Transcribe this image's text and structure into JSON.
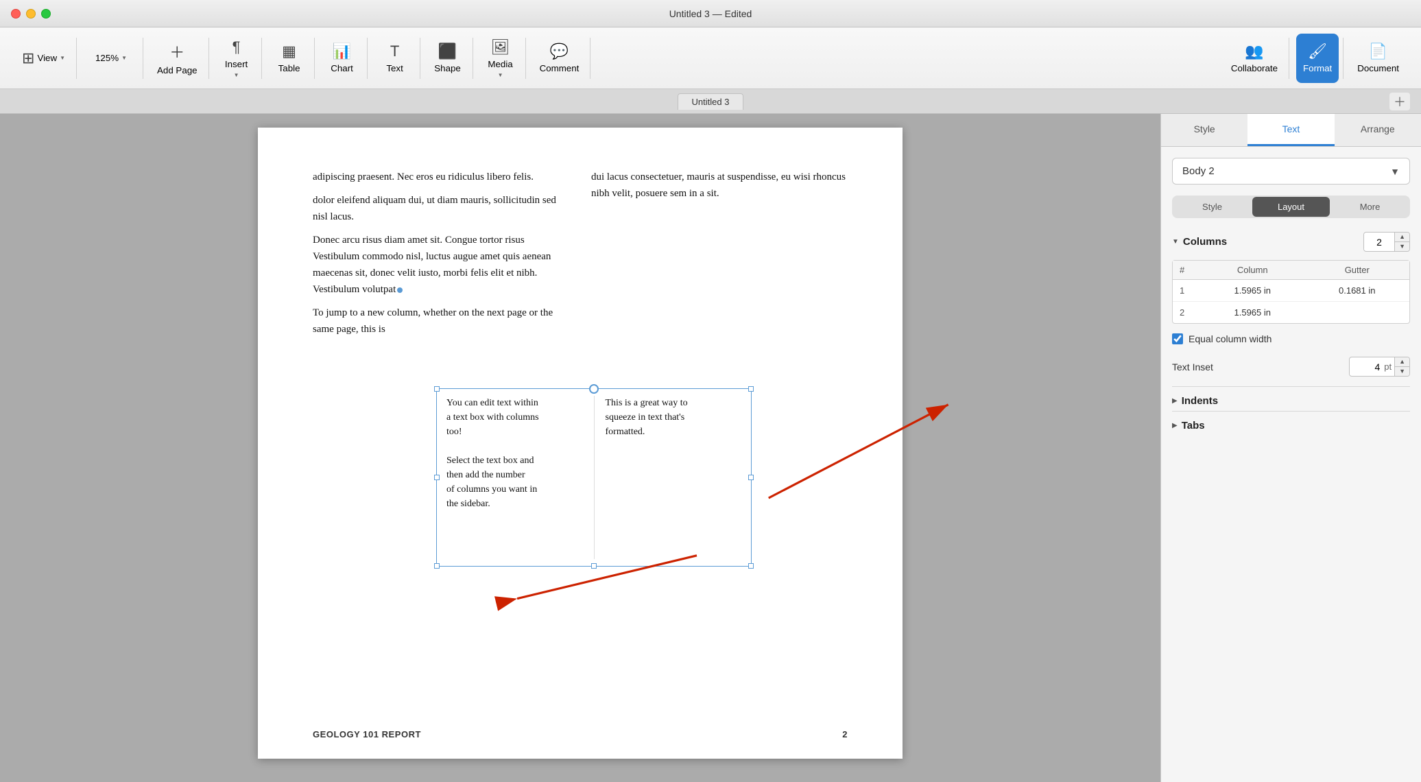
{
  "window": {
    "title": "Untitled 3 — Edited",
    "lock_icon": "🔒"
  },
  "titlebar_dots": {
    "red": "red",
    "yellow": "yellow",
    "green": "green"
  },
  "toolbar": {
    "view_label": "View",
    "zoom_label": "125%",
    "add_page_label": "Add Page",
    "insert_label": "Insert",
    "table_label": "Table",
    "chart_label": "Chart",
    "text_label": "Text",
    "shape_label": "Shape",
    "media_label": "Media",
    "comment_label": "Comment",
    "collaborate_label": "Collaborate",
    "format_label": "Format",
    "document_label": "Document"
  },
  "tab_bar": {
    "doc_name": "Untitled 3"
  },
  "page": {
    "body_text_col1_p1": "adipiscing praesent. Nec eros eu ridiculus libero felis.",
    "body_text_col1_p2": "Donec arcu risus diam amet sit. Congue tortor risus Vestibulum commodo nisl, luctus augue amet quis aenean maecenas sit, donec velit iusto, morbi felis elit et nibh. Vestibulum volutpat",
    "body_text_col1_p3": "dui lacus consectetuer, mauris at suspendisse, eu wisi rhoncus nibh velit, posuere sem in a sit.",
    "body_text_col2_p1": "dolor eleifend aliquam dui, ut diam mauris, sollicitudin sed nisl lacus.",
    "body_text_col2_p2": "To jump to a new column, whether on the next page or the same page, this is",
    "footer_left": "GEOLOGY 101 REPORT",
    "footer_right": "2"
  },
  "text_box": {
    "col1_line1": "You can edit text within",
    "col1_line2": "a text box with columns",
    "col1_line3": "too!",
    "col1_line4": "Select the text box and",
    "col1_line5": "then add the number",
    "col1_line6": "of columns you want in",
    "col1_line7": "the sidebar.",
    "col2_line1": "This is a great way to",
    "col2_line2": "squeeze in text that's",
    "col2_line3": "formatted."
  },
  "sidebar": {
    "tab_style": "Style",
    "tab_text": "Text",
    "tab_arrange": "Arrange",
    "active_tab": "Text",
    "style_dropdown": {
      "label": "Body 2",
      "chevron": "▼"
    },
    "sub_tabs": {
      "style": "Style",
      "layout": "Layout",
      "more": "More",
      "active": "Layout"
    },
    "columns_section": {
      "title": "Columns",
      "count": "2",
      "table_headers": {
        "hash": "#",
        "column": "Column",
        "gutter": "Gutter"
      },
      "rows": [
        {
          "num": "1",
          "column": "1.5965 in",
          "gutter": "0.1681 in"
        },
        {
          "num": "2",
          "column": "1.5965 in",
          "gutter": ""
        }
      ],
      "equal_column_width": "Equal column width"
    },
    "text_inset": {
      "label": "Text Inset",
      "value": "4",
      "unit": "pt"
    },
    "indents": {
      "title": "Indents"
    },
    "tabs_section": {
      "title": "Tabs"
    }
  }
}
